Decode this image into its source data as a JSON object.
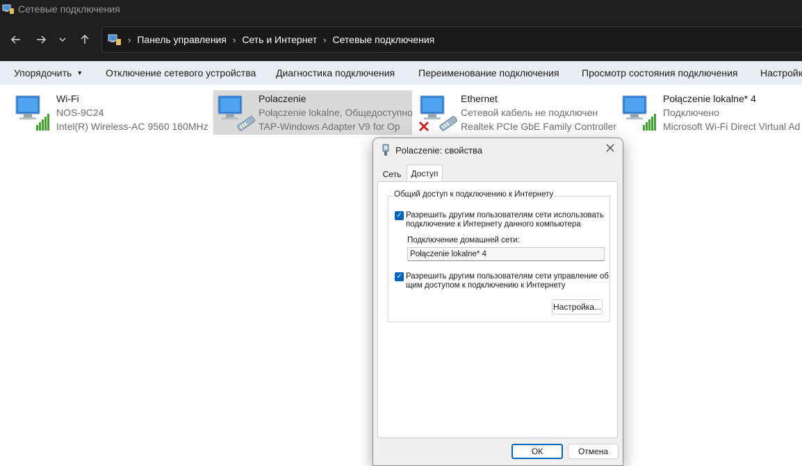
{
  "window": {
    "title": "Сетевые подключения"
  },
  "nav": {
    "back_icon": "arrow-left-icon",
    "forward_icon": "arrow-right-icon",
    "recent_icon": "chevron-down-icon",
    "up_icon": "arrow-up-icon",
    "breadcrumb": [
      "Панель управления",
      "Сеть и Интернет",
      "Сетевые подключения"
    ]
  },
  "toolbar": {
    "organize": "Упорядочить",
    "disable": "Отключение сетевого устройства",
    "diagnose": "Диагностика подключения",
    "rename": "Переименование подключения",
    "status": "Просмотр состояния подключения",
    "settings": "Настройк"
  },
  "connections": [
    {
      "name": "Wi-Fi",
      "status": "NOS-9C24",
      "adapter": "Intel(R) Wireless-AC 9560 160MHz",
      "icon": "wifi-adapter-icon"
    },
    {
      "name": "Polaczenie",
      "status": "Połączenie lokalne, Общедоступно",
      "adapter": "TAP-Windows Adapter V9 for Op",
      "icon": "network-cable-icon"
    },
    {
      "name": "Ethernet",
      "status": "Сетевой кабель не подключен",
      "adapter": "Realtek PCIe GbE Family Controller",
      "icon": "network-disconnected-icon"
    },
    {
      "name": "Połączenie lokalne* 4",
      "status": "Подключено",
      "adapter": "Microsoft Wi-Fi Direct Virtual Ad",
      "icon": "wifi-adapter-icon"
    }
  ],
  "dialog": {
    "title": "Polaczenie: свойства",
    "tabs": [
      "Сеть",
      "Доступ"
    ],
    "group_title": "Общий доступ к подключению к Интернету",
    "allow_sharing_line1": "Разрешить другим пользователям сети использовать",
    "allow_sharing_line2": "подключение к Интернету данного компьютера",
    "allow_sharing_checked": true,
    "home_network_label": "Подключение домашней сети:",
    "home_network_value": "Połączenie lokalne* 4",
    "allow_control_line1": "Разрешить другим пользователям сети управление об",
    "allow_control_line2": "щим доступом к подключению к Интернету",
    "allow_control_checked": true,
    "settings_button": "Настройка...",
    "ok_button": "ОК",
    "cancel_button": "Отмена"
  }
}
